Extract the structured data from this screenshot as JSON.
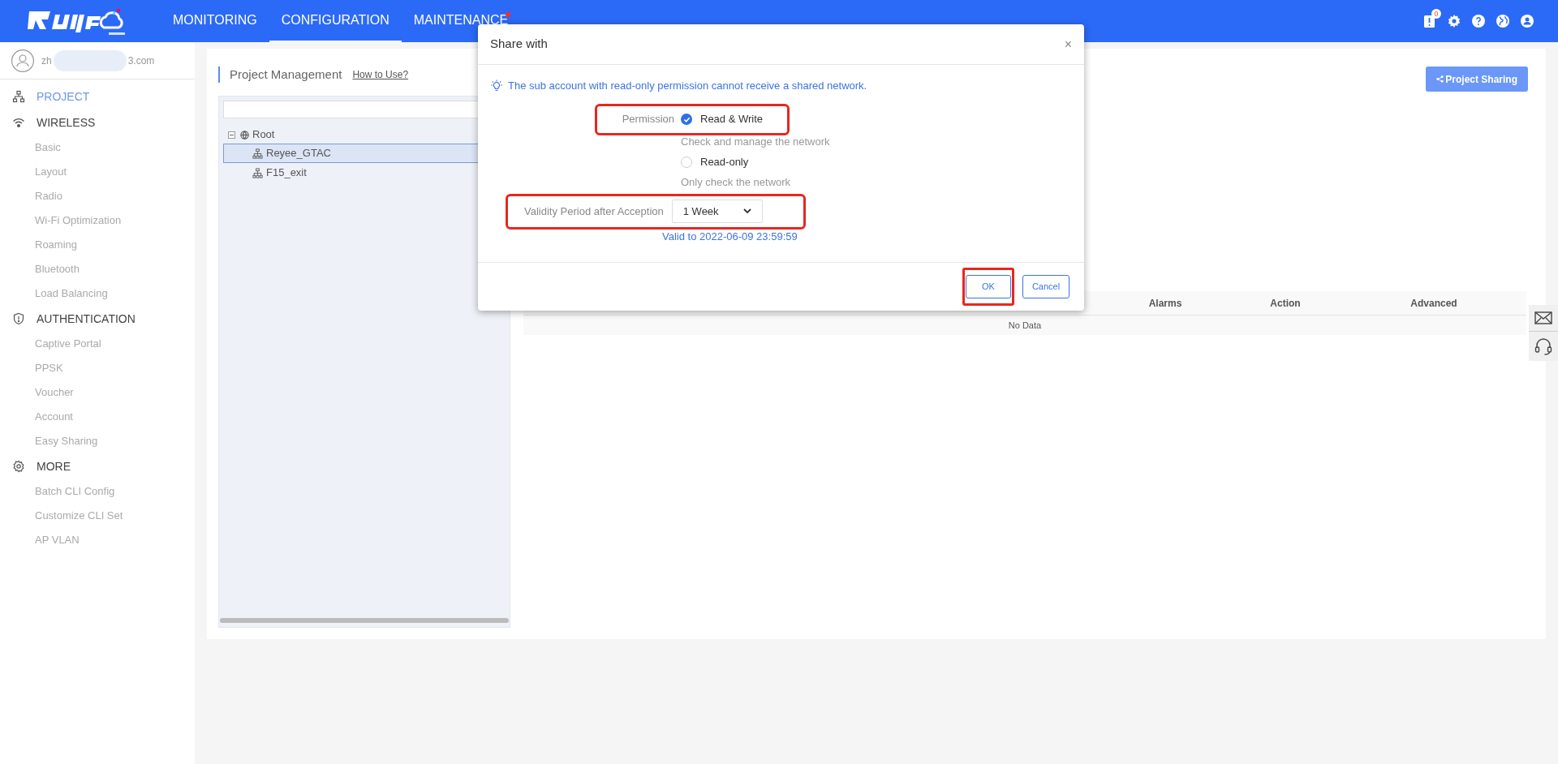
{
  "header": {
    "nav": [
      {
        "label": "MONITORING",
        "selected": false,
        "dot": false
      },
      {
        "label": "CONFIGURATION",
        "selected": true,
        "dot": false
      },
      {
        "label": "MAINTENANCE",
        "selected": false,
        "dot": true
      }
    ],
    "alert_count": "0"
  },
  "user": {
    "email_start": "zh",
    "email_end": "3.com"
  },
  "sidebar": {
    "sections": [
      {
        "kind": "project",
        "label": "PROJECT",
        "selected": true
      },
      {
        "kind": "wireless",
        "label": "WIRELESS",
        "selected": false,
        "children": [
          "Basic",
          "Layout",
          "Radio",
          "Wi-Fi Optimization",
          "Roaming",
          "Bluetooth",
          "Load Balancing"
        ]
      },
      {
        "kind": "auth",
        "label": "AUTHENTICATION",
        "selected": false,
        "children": [
          "Captive Portal",
          "PPSK",
          "Voucher",
          "Account",
          "Easy Sharing"
        ]
      },
      {
        "kind": "more",
        "label": "MORE",
        "selected": false,
        "children": [
          "Batch CLI Config",
          "Customize CLI Set",
          "AP VLAN"
        ]
      }
    ]
  },
  "page": {
    "title": "Project Management",
    "help_link": "How to Use?",
    "share_button": "Project Sharing"
  },
  "tree": {
    "label": "Root",
    "expanded": true,
    "children": [
      {
        "label": "Reyee_GTAC",
        "selected": true
      },
      {
        "label": "F15_exit",
        "selected": false
      }
    ]
  },
  "table": {
    "columns": [
      "Alarms",
      "Action",
      "Advanced"
    ],
    "empty_text": "No Data"
  },
  "dialog": {
    "title": "Share with",
    "close": "×",
    "tip": "The sub account with read-only permission cannot receive a shared network.",
    "permission": {
      "label": "Permission",
      "highlighted": true,
      "options": [
        {
          "label": "Read & Write",
          "description": "Check and manage the network",
          "selected": true
        },
        {
          "label": "Read-only",
          "description": "Only check the network",
          "selected": false
        }
      ]
    },
    "validity": {
      "label": "Validity Period after Acception",
      "value": "1 Week",
      "note": "Valid to 2022-06-09 23:59:59",
      "highlighted": true
    },
    "buttons": [
      {
        "label": "OK",
        "highlighted": true
      },
      {
        "label": "Cancel",
        "highlighted": false
      }
    ]
  }
}
